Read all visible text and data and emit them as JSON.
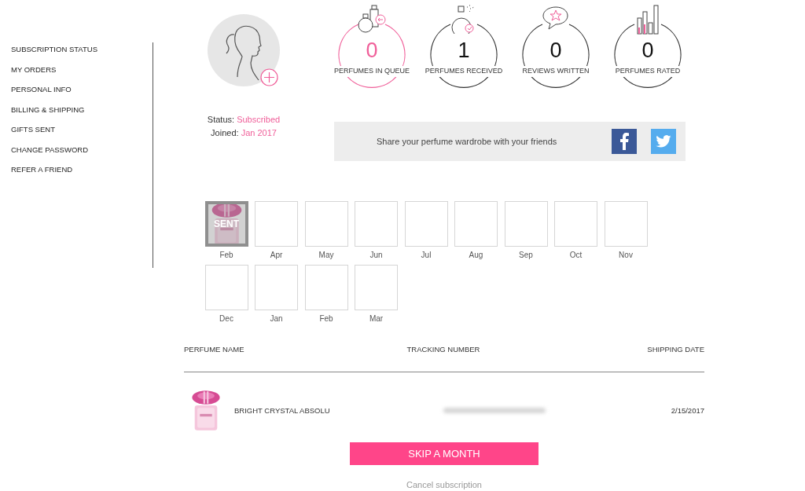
{
  "sidebar": {
    "items": [
      {
        "label": "SUBSCRIPTION STATUS"
      },
      {
        "label": "MY ORDERS"
      },
      {
        "label": "PERSONAL INFO"
      },
      {
        "label": "BILLING & SHIPPING"
      },
      {
        "label": "GIFTS SENT"
      },
      {
        "label": "CHANGE PASSWORD"
      },
      {
        "label": "REFER A FRIEND"
      }
    ]
  },
  "profile": {
    "status_label": "Status:",
    "status": "Subscribed",
    "joined_label": "Joined:",
    "joined": "Jan 2017"
  },
  "stats": [
    {
      "kind": "queue",
      "value": "0",
      "label": "PERFUMES IN QUEUE",
      "selected": true
    },
    {
      "kind": "received",
      "value": "1",
      "label": "PERFUMES RECEIVED",
      "selected": false
    },
    {
      "kind": "reviews",
      "value": "0",
      "label": "REVIEWS WRITTEN",
      "selected": false
    },
    {
      "kind": "rated",
      "value": "0",
      "label": "PERFUMES RATED",
      "selected": false
    }
  ],
  "share": {
    "text": "Share your perfume wardrobe with your friends"
  },
  "months": [
    {
      "label": "Feb",
      "sent": true,
      "badge": "SENT"
    },
    {
      "label": "Apr",
      "sent": false
    },
    {
      "label": "May",
      "sent": false
    },
    {
      "label": "Jun",
      "sent": false
    },
    {
      "label": "Jul",
      "sent": false
    },
    {
      "label": "Aug",
      "sent": false
    },
    {
      "label": "Sep",
      "sent": false
    },
    {
      "label": "Oct",
      "sent": false
    },
    {
      "label": "Nov",
      "sent": false
    },
    {
      "label": "Dec",
      "sent": false
    },
    {
      "label": "Jan",
      "sent": false
    },
    {
      "label": "Feb",
      "sent": false
    },
    {
      "label": "Mar",
      "sent": false
    }
  ],
  "table": {
    "columns": [
      "PERFUME NAME",
      "TRACKING NUMBER",
      "SHIPPING DATE"
    ],
    "rows": [
      {
        "name": "BRIGHT CRYSTAL ABSOLU",
        "date": "2/15/2017"
      }
    ]
  },
  "skip_button": "SKIP A MONTH",
  "cancel_link": "Cancel subscription"
}
